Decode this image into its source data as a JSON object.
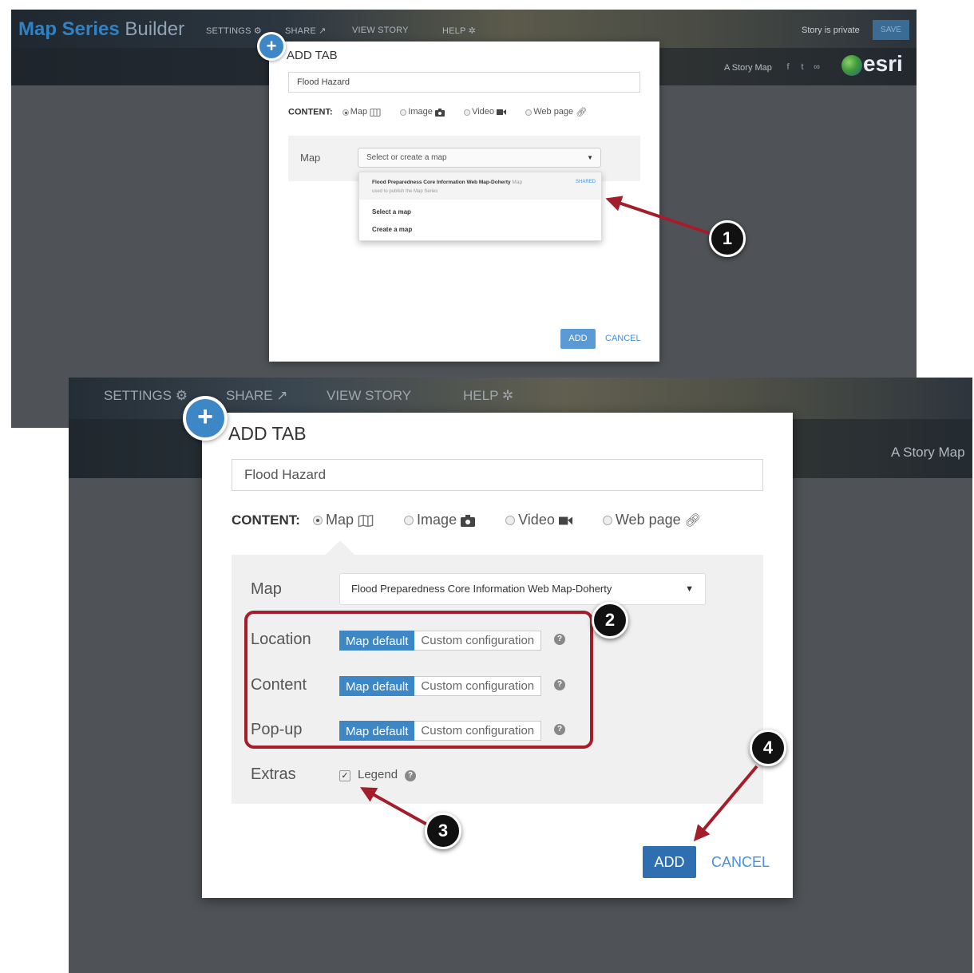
{
  "top_screenshot": {
    "app_title_bold": "Map Series",
    "app_title_light": "Builder",
    "nav": [
      "SETTINGS",
      "SHARE",
      "VIEW STORY",
      "HELP"
    ],
    "privacy": "Story is private",
    "save_label": "SAVE",
    "story_map_label": "A Story Map",
    "esri_logo": "esri",
    "dialog": {
      "title": "ADD TAB",
      "tab_name": "Flood Hazard",
      "content_label": "CONTENT:",
      "content_options": [
        "Map",
        "Image",
        "Video",
        "Web page"
      ],
      "selected_option": "Map",
      "map_label": "Map",
      "select_placeholder": "Select or create a map",
      "dropdown": {
        "item_title": "Flood Preparedness Core Information Web Map-Doherty",
        "item_suffix": "Map",
        "item_subtitle": "used to publish the Map Series",
        "item_badge": "SHARED",
        "options": [
          "Select a map",
          "Create a map"
        ]
      },
      "add_label": "ADD",
      "cancel_label": "CANCEL"
    }
  },
  "bottom_screenshot": {
    "nav": [
      "SETTINGS",
      "SHARE",
      "VIEW STORY",
      "HELP"
    ],
    "story_map_label": "A Story Map",
    "dialog": {
      "title": "ADD TAB",
      "tab_name": "Flood Hazard",
      "content_label": "CONTENT:",
      "content_options": [
        "Map",
        "Image",
        "Video",
        "Web page"
      ],
      "selected_option": "Map",
      "map_label": "Map",
      "map_selected": "Flood Preparedness Core Information Web Map-Doherty",
      "settings": [
        {
          "label": "Location",
          "active": "Map default",
          "alternative": "Custom configuration"
        },
        {
          "label": "Content",
          "active": "Map default",
          "alternative": "Custom configuration"
        },
        {
          "label": "Pop-up",
          "active": "Map default",
          "alternative": "Custom configuration"
        }
      ],
      "extras_label": "Extras",
      "legend_label": "Legend",
      "legend_checked": true,
      "add_label": "ADD",
      "cancel_label": "CANCEL"
    }
  },
  "callouts": [
    "1",
    "2",
    "3",
    "4"
  ],
  "colors": {
    "accent_blue": "#3d87c7",
    "annotation_red": "#a31d2b",
    "header_dark": "#2c3640",
    "background": "#4f5357"
  }
}
